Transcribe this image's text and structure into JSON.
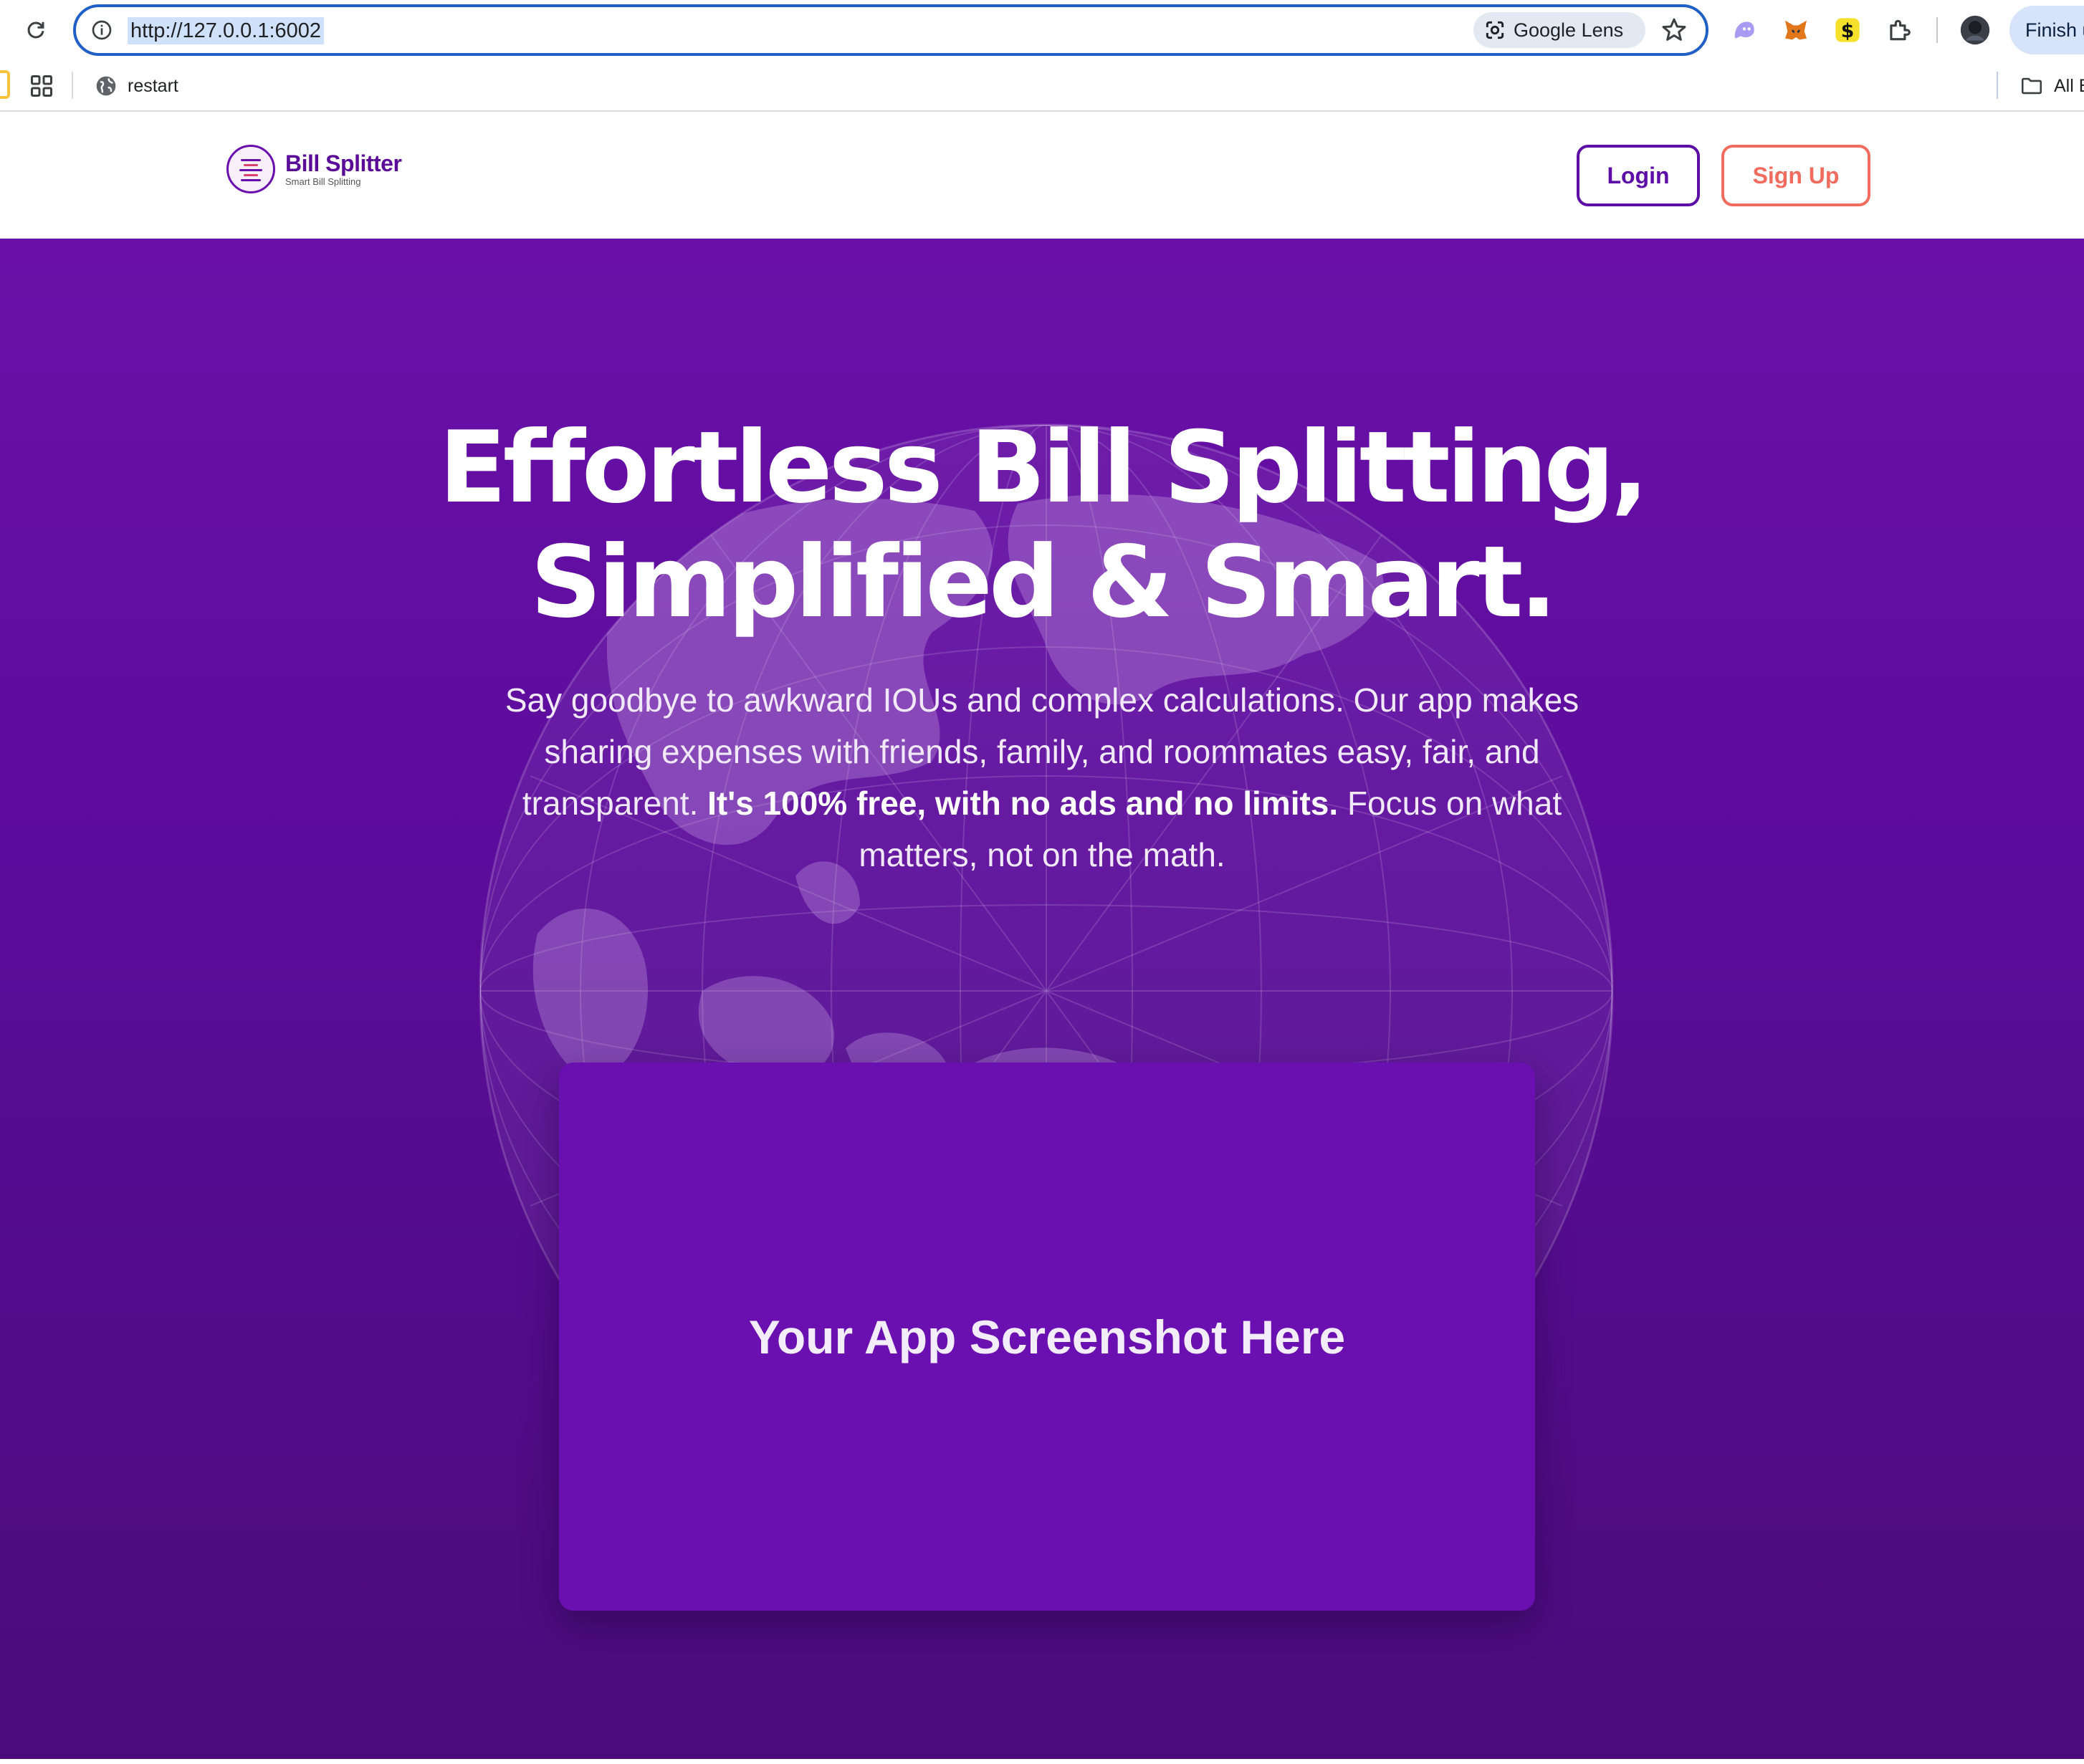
{
  "browser": {
    "url": "http://127.0.0.1:6002",
    "lens_label": "Google Lens",
    "profile_button_label": "Finish update",
    "bookmarks": [
      {
        "label": "restart"
      }
    ],
    "all_bookmarks_label": "All Bookmarks"
  },
  "header": {
    "brand_name": "Bill Splitter",
    "brand_tagline": "Smart Bill Splitting",
    "login_label": "Login",
    "signup_label": "Sign Up"
  },
  "hero": {
    "title_line1": "Effortless Bill Splitting,",
    "title_line2": "Simplified & Smart.",
    "subtitle_pre": "Say goodbye to awkward IOUs and complex calculations. Our app makes sharing expenses with friends, family, and roommates easy, fair, and transparent.",
    "subtitle_bold": "It's 100% free, with no ads and no limits.",
    "subtitle_post": "Focus on what matters, not on the math.",
    "screenshot_placeholder": "Your App Screenshot Here"
  },
  "colors": {
    "brand_purple": "#6a0dad",
    "hero_top": "#6a10a8",
    "hero_bottom": "#4a0c7a",
    "signup_coral": "#f26b5f",
    "omnibox_focus": "#1f5fc6"
  },
  "icons": [
    "reload-icon",
    "site-info-icon",
    "google-lens-icon",
    "bookmark-star-icon",
    "ghost-extension-icon",
    "metamask-extension-icon",
    "dollar-extension-icon",
    "extensions-puzzle-icon",
    "profile-avatar-icon",
    "apps-grid-icon",
    "globe-favicon-icon",
    "folder-icon",
    "bill-splitter-logo-icon",
    "globe-background-icon"
  ]
}
